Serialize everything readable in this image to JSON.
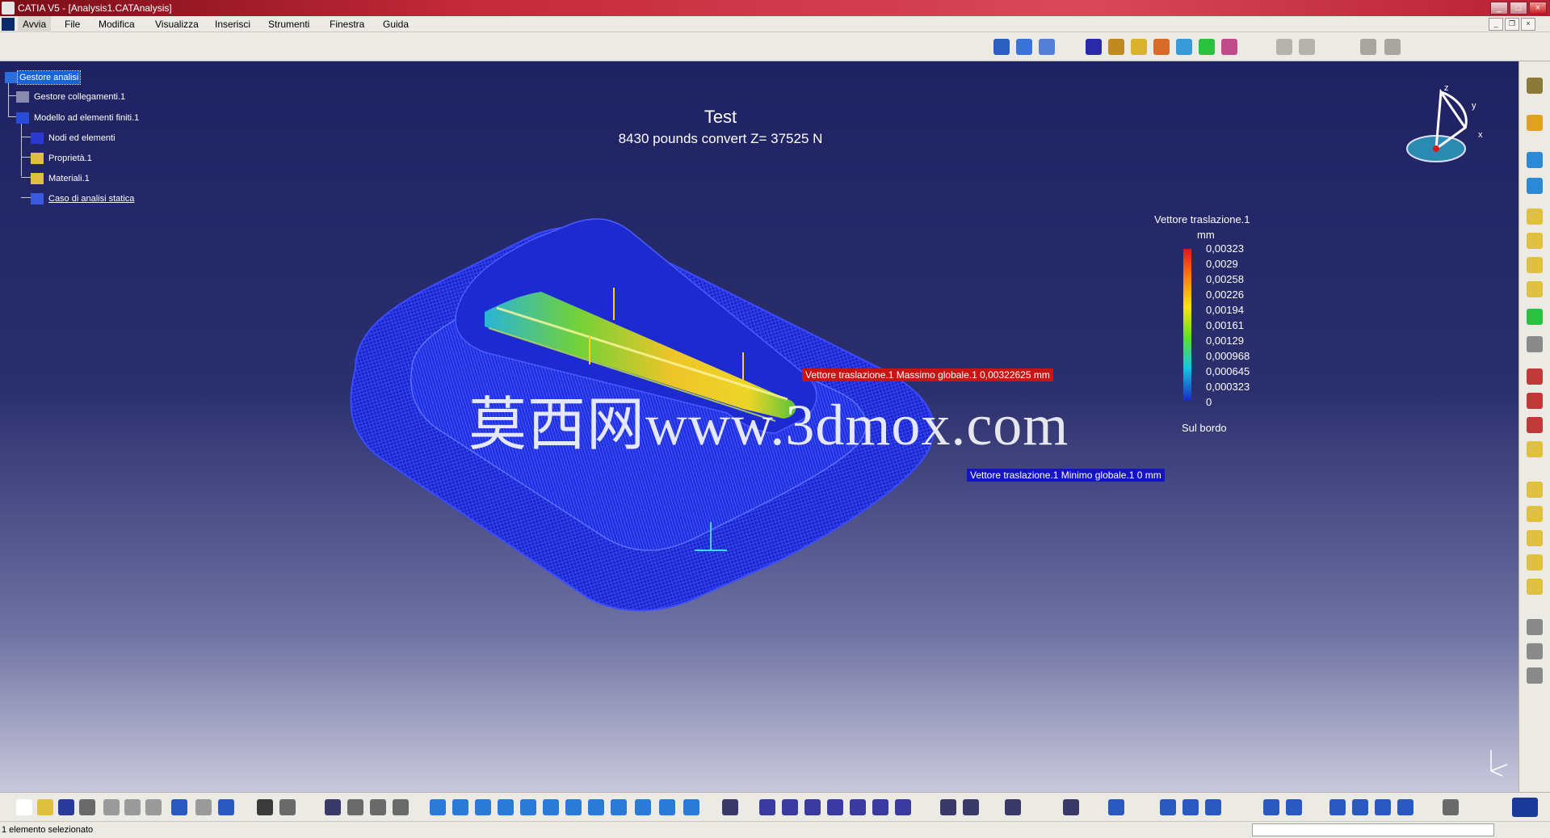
{
  "window": {
    "title": "CATIA V5 - [Analysis1.CATAnalysis]"
  },
  "menu": {
    "items": [
      {
        "label": "Avvia"
      },
      {
        "label": "File"
      },
      {
        "label": "Modifica"
      },
      {
        "label": "Visualizza"
      },
      {
        "label": "Inserisci"
      },
      {
        "label": "Strumenti"
      },
      {
        "label": "Finestra"
      },
      {
        "label": "Guida"
      }
    ]
  },
  "tree": {
    "items": [
      {
        "label": "Gestore analisi"
      },
      {
        "label": "Gestore collegamenti.1"
      },
      {
        "label": "Modello ad elementi finiti.1"
      },
      {
        "label": "Nodi ed elementi"
      },
      {
        "label": "Proprietà.1"
      },
      {
        "label": "Materiali.1"
      },
      {
        "label": "Caso di analisi statica"
      }
    ]
  },
  "caption": {
    "title": "Test",
    "subtitle": "8430 pounds convert Z= 37525 N"
  },
  "watermark": "莫西网www.3dmox.com",
  "annotations": {
    "max": "Vettore traslazione.1  Massimo globale.1  0,00322625 mm",
    "min": "Vettore traslazione.1  Minimo globale.1  0 mm"
  },
  "legend": {
    "title": "Vettore traslazione.1",
    "unit": "mm",
    "values": [
      "0,00323",
      "0,0029",
      "0,00258",
      "0,00226",
      "0,00194",
      "0,00161",
      "0,00129",
      "0,000968",
      "0,000645",
      "0,000323",
      "0"
    ],
    "footer": "Sul bordo",
    "colors": [
      "#d81a1a",
      "#ff7a1a",
      "#ffe01a",
      "#5fe02a",
      "#14c8e0",
      "#1a2ac8"
    ]
  },
  "compass_axes": {
    "z": "z",
    "y": "y",
    "x": "x"
  },
  "status": {
    "text": "1 elemento selezionato"
  },
  "colors": {
    "title_bar": "#c4293a",
    "background_top": "#1e2262",
    "background_bottom": "#c9c9dc",
    "mesh_blue": "#2233ff",
    "selection": "#1664d9"
  }
}
